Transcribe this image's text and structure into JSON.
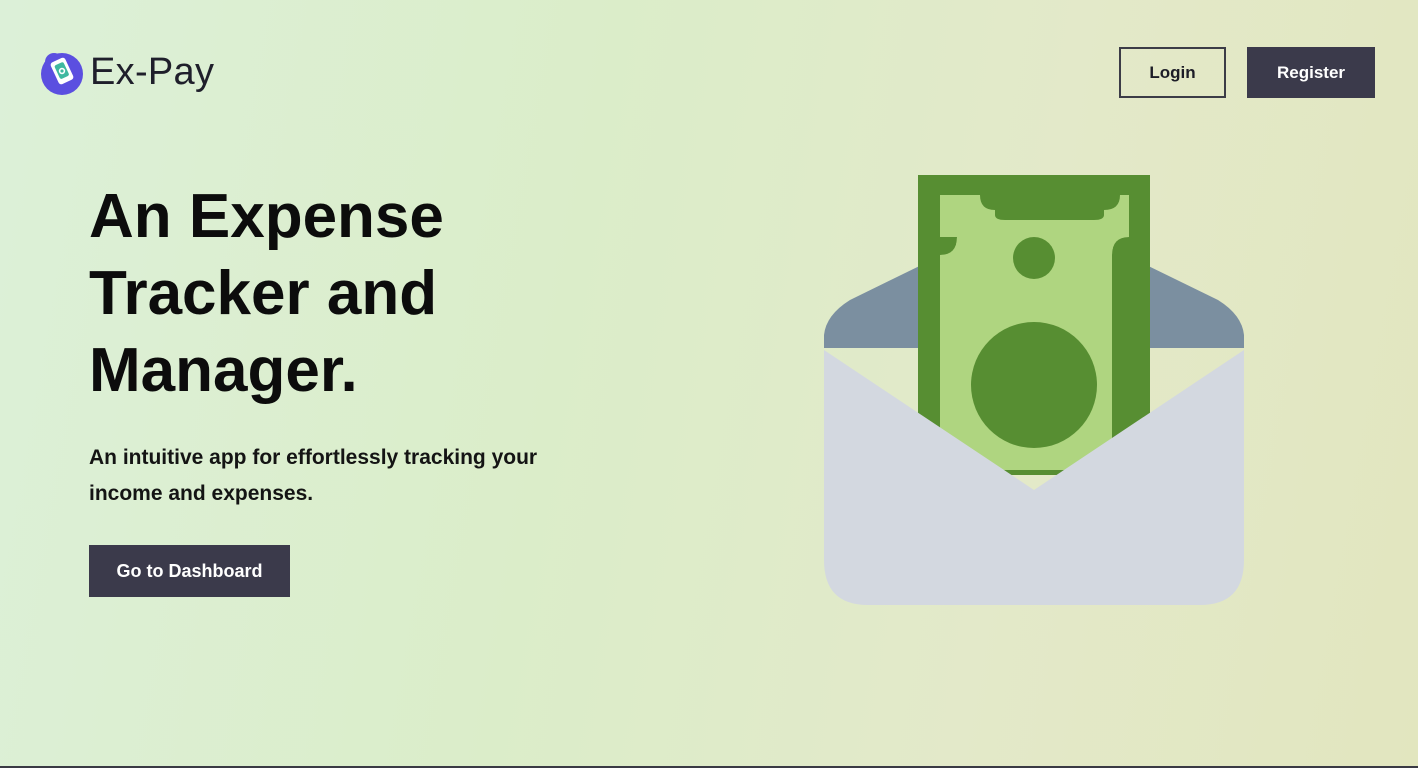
{
  "brand": {
    "name": "Ex-Pay",
    "logo_icon": "wallet-money-icon"
  },
  "header": {
    "login_label": "Login",
    "register_label": "Register"
  },
  "hero": {
    "title": "An Expense Tracker and Manager.",
    "subtitle": "An intuitive app for effortlessly tracking your income and expenses.",
    "cta_label": "Go to Dashboard",
    "illustration_icon": "money-envelope-icon"
  },
  "colors": {
    "button_dark": "#3b3a4b",
    "logo_purple": "#5b4fe0",
    "bill_dark_green": "#578e32",
    "bill_light_green": "#afd580",
    "envelope_flap": "#7b8fa0",
    "envelope_body": "#d3d8e0"
  }
}
